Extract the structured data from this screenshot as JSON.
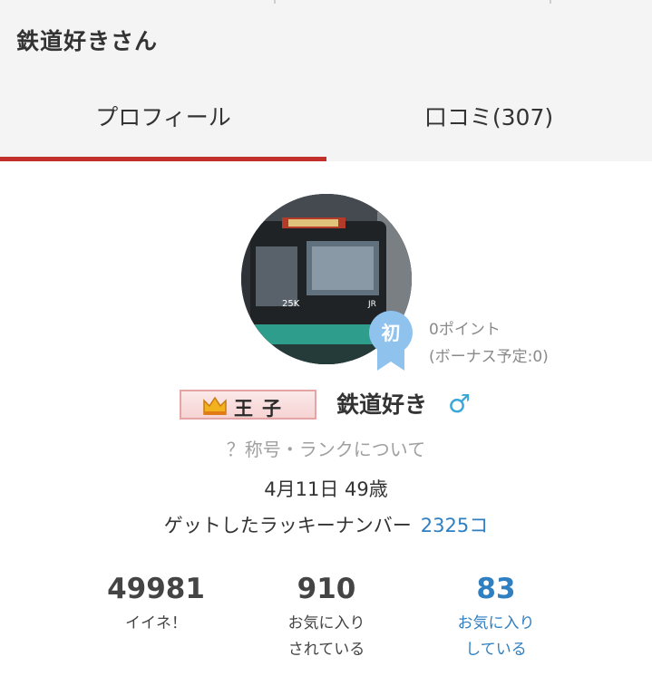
{
  "header": {
    "title": "鉄道好きさん"
  },
  "tabs": [
    {
      "label": "プロフィール",
      "active": true
    },
    {
      "label": "口コミ(307)",
      "active": false
    }
  ],
  "colors": {
    "accent_red": "#c3302b",
    "link_blue": "#2f7fc1",
    "gender_blue": "#3aa7d8",
    "badge_blue": "#8fc3ee"
  },
  "profile": {
    "avatar_icon": "train-photo",
    "badge_label": "初",
    "points": "0ポイント",
    "bonus": "(ボーナス予定:0)",
    "rank_icon": "crown-icon",
    "rank_title": "王子",
    "username": "鉄道好き",
    "gender_symbol": "♂",
    "rank_info_link": "？称号・ランクについて",
    "birthday": "4月11日 49歳",
    "lucky_label": "ゲットしたラッキーナンバー",
    "lucky_count": "2325コ"
  },
  "stats": {
    "likes": {
      "value": "49981",
      "label": "イイネ！"
    },
    "favorited_by": {
      "value": "910",
      "label_line1": "お気に入り",
      "label_line2": "されている"
    },
    "favorites": {
      "value": "83",
      "label_line1": "お気に入り",
      "label_line2": "している"
    }
  }
}
